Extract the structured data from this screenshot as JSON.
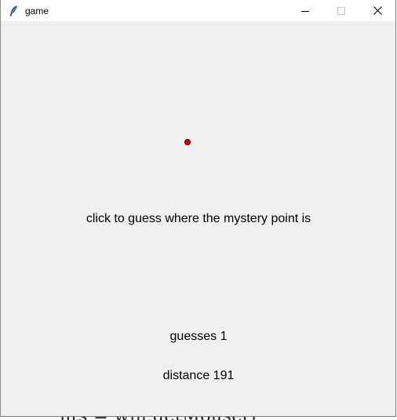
{
  "window": {
    "title": "game",
    "app_icon": "feather-icon",
    "controls": [
      "minimize-icon",
      "maximize-icon",
      "close-icon"
    ]
  },
  "game": {
    "prompt": "click to guess where the mystery point is",
    "guesses_text": "guesses 1",
    "distance_text": "distance 191",
    "marker_color": "#e00000"
  },
  "background": {
    "partial_text": "nts = win.getMouse()"
  }
}
